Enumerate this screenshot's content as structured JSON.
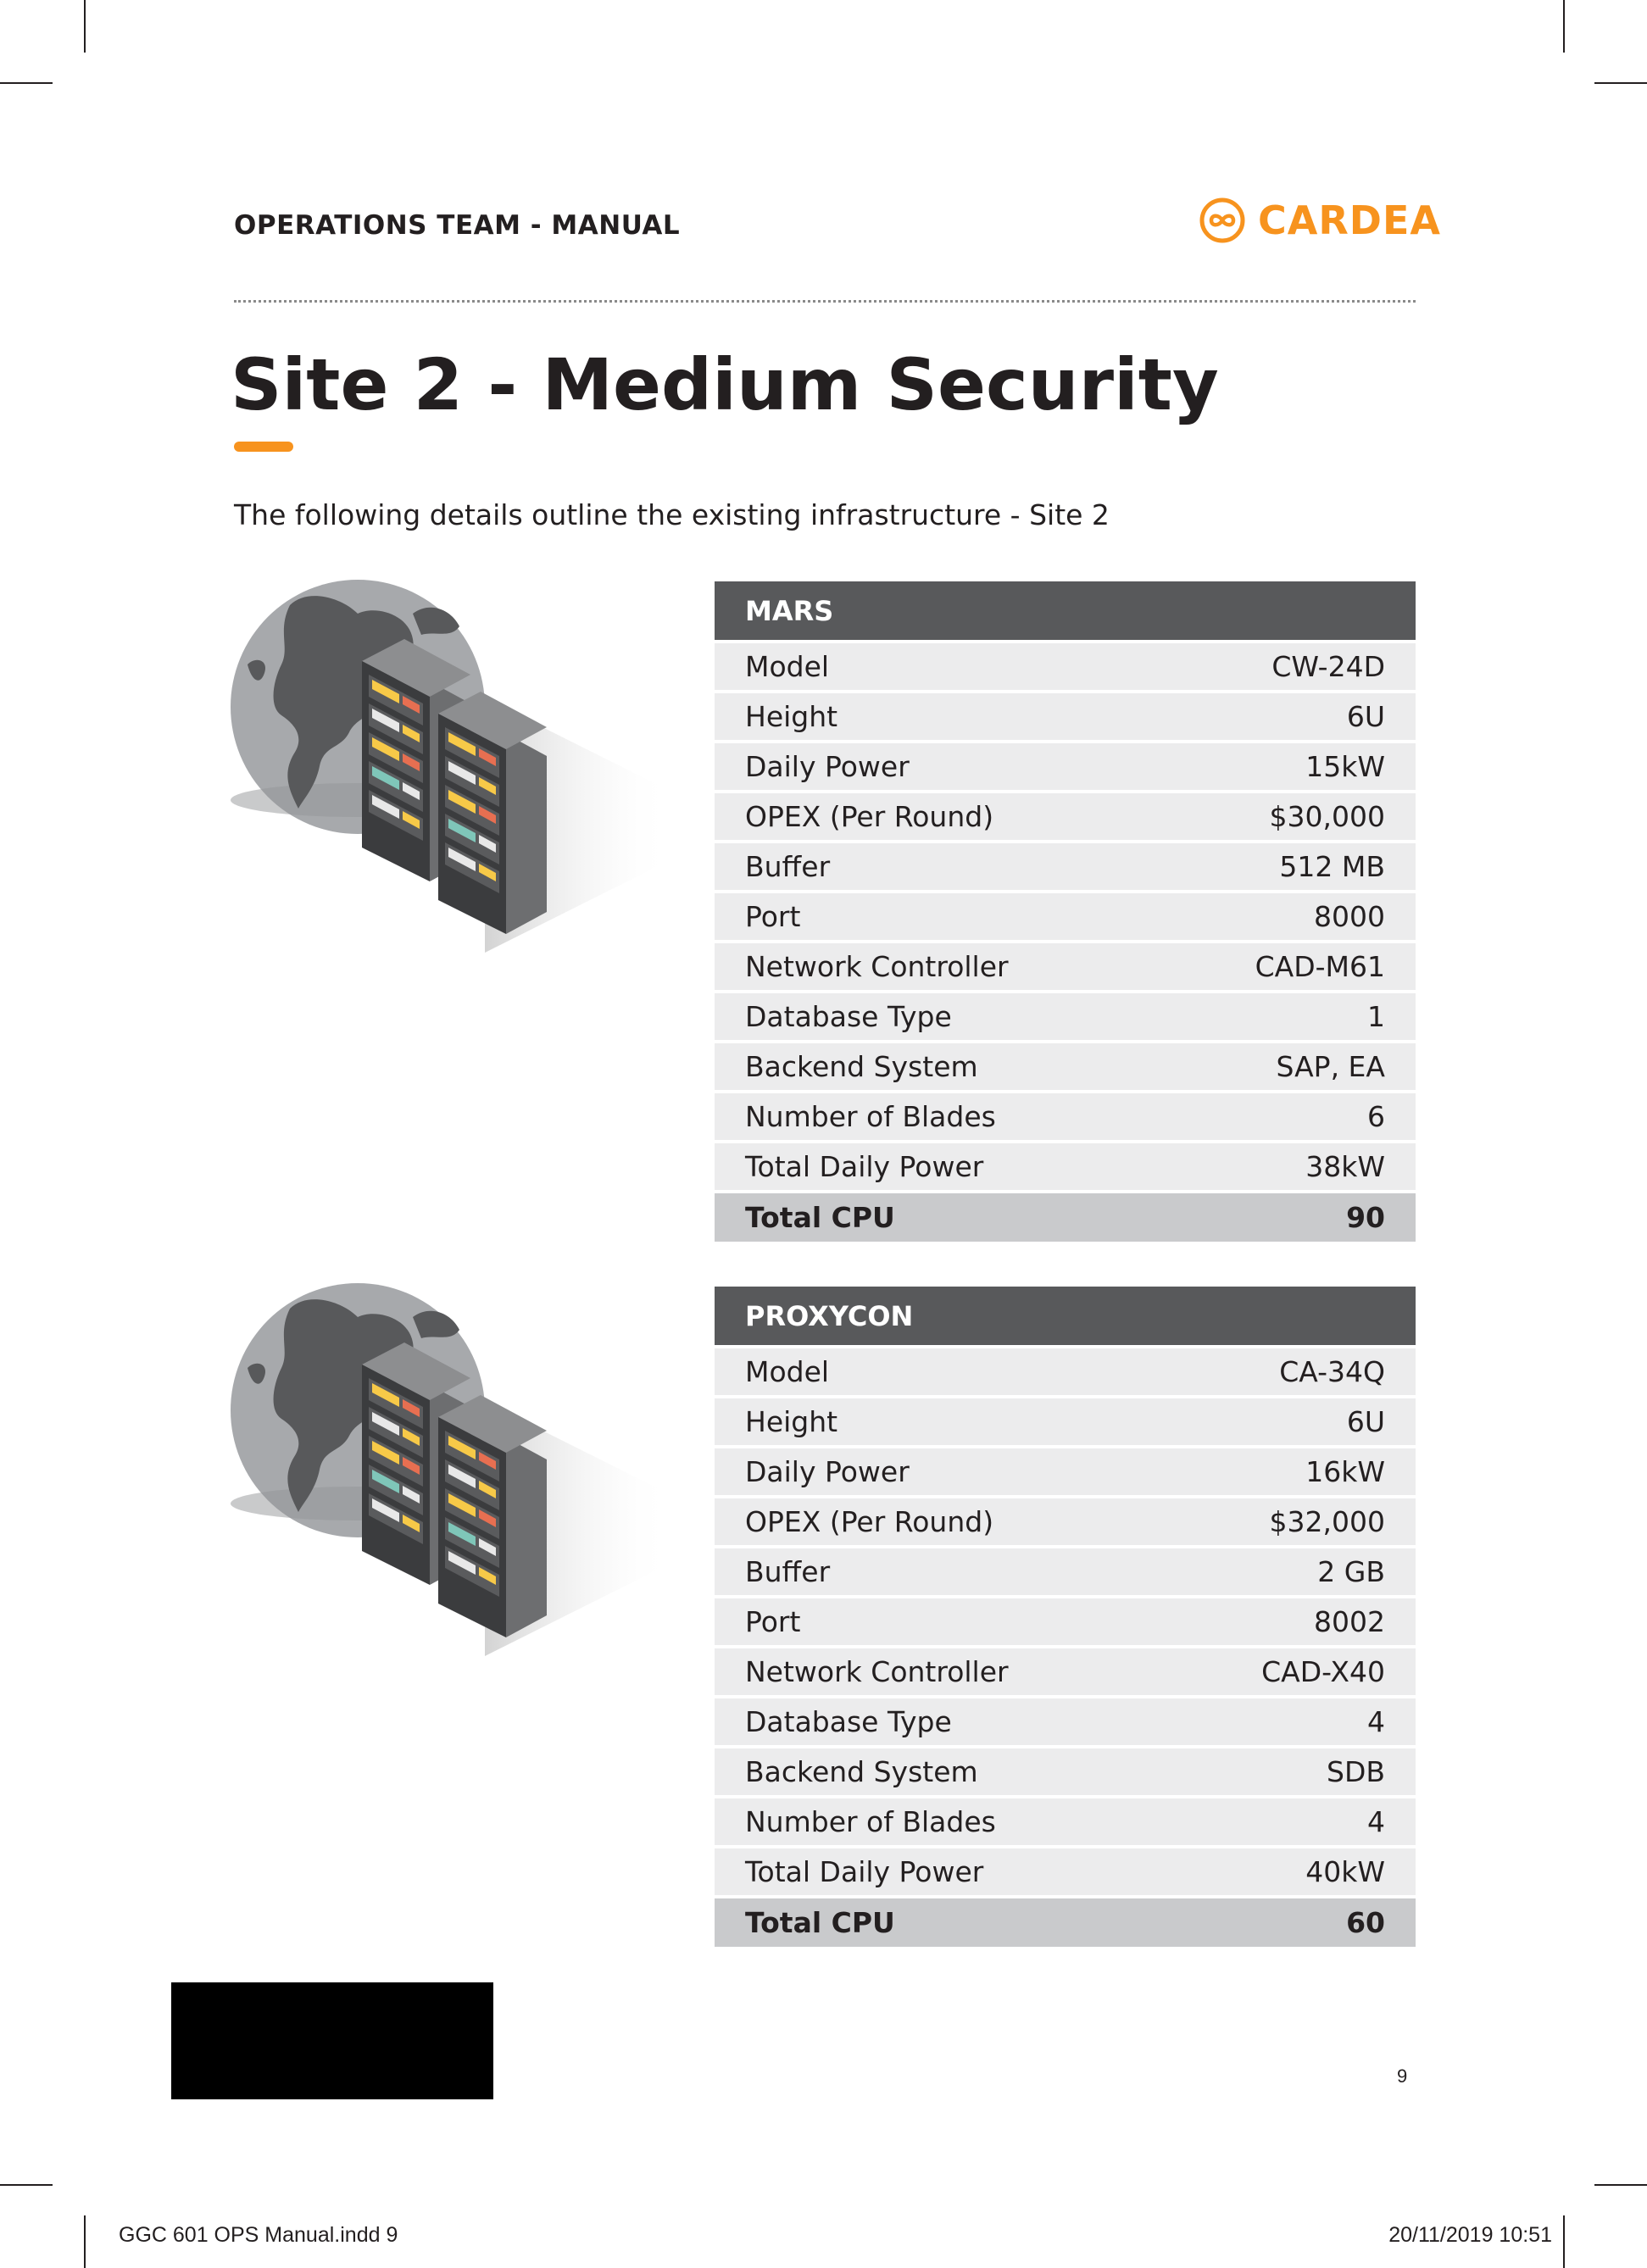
{
  "header": {
    "title": "OPERATIONS TEAM - MANUAL",
    "brand": "CARDEA",
    "brand_color": "#f7931e",
    "brand_icon": "infinity-circle-icon"
  },
  "page": {
    "title": "Site 2 - Medium Security",
    "intro": "The following details outline the existing infrastructure - Site 2",
    "page_number": "9"
  },
  "illustration": {
    "icon": "globe-server-rack-icon"
  },
  "tables": [
    {
      "name": "MARS",
      "rows": [
        {
          "label": "Model",
          "value": "CW-24D"
        },
        {
          "label": "Height",
          "value": "6U"
        },
        {
          "label": "Daily Power",
          "value": "15kW"
        },
        {
          "label": "OPEX (Per Round)",
          "value": "$30,000"
        },
        {
          "label": "Buffer",
          "value": "512 MB"
        },
        {
          "label": "Port",
          "value": "8000"
        },
        {
          "label": "Network Controller",
          "value": "CAD-M61"
        },
        {
          "label": "Database Type",
          "value": "1"
        },
        {
          "label": "Backend System",
          "value": "SAP, EA"
        },
        {
          "label": "Number of Blades",
          "value": "6"
        },
        {
          "label": "Total Daily Power",
          "value": "38kW"
        }
      ],
      "total": {
        "label": "Total CPU",
        "value": "90"
      }
    },
    {
      "name": "PROXYCON",
      "rows": [
        {
          "label": "Model",
          "value": "CA-34Q"
        },
        {
          "label": "Height",
          "value": "6U"
        },
        {
          "label": "Daily Power",
          "value": "16kW"
        },
        {
          "label": "OPEX (Per Round)",
          "value": "$32,000"
        },
        {
          "label": "Buffer",
          "value": "2 GB"
        },
        {
          "label": "Port",
          "value": "8002"
        },
        {
          "label": "Network Controller",
          "value": "CAD-X40"
        },
        {
          "label": "Database Type",
          "value": "4"
        },
        {
          "label": "Backend System",
          "value": "SDB"
        },
        {
          "label": "Number of Blades",
          "value": "4"
        },
        {
          "label": "Total Daily Power",
          "value": "40kW"
        }
      ],
      "total": {
        "label": "Total CPU",
        "value": "60"
      }
    }
  ],
  "slug": {
    "file": "GGC 601 OPS Manual.indd   9",
    "timestamp": "20/11/2019   10:51"
  }
}
